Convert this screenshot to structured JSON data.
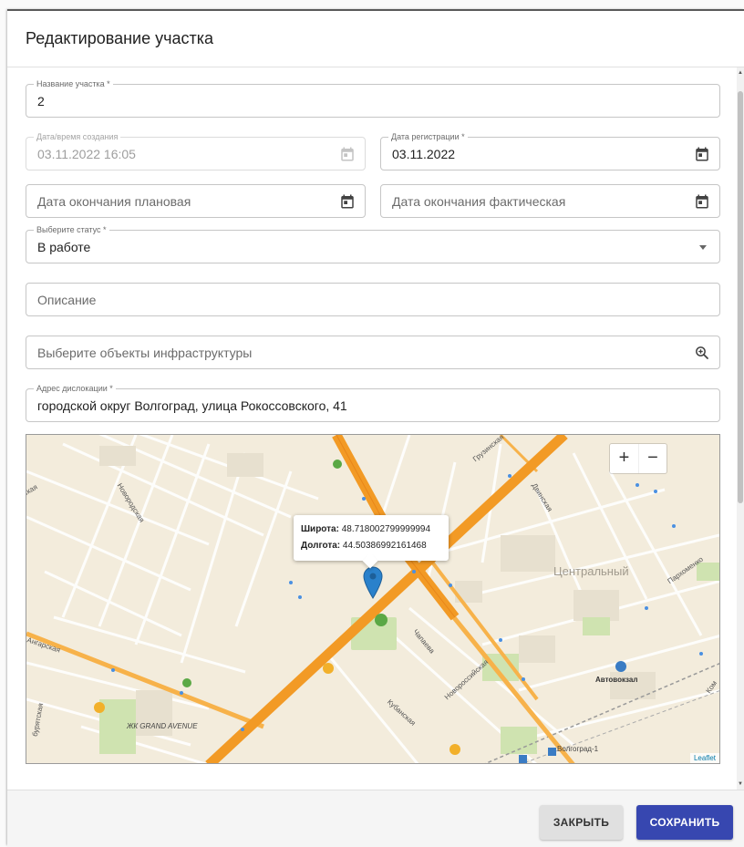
{
  "dialog": {
    "title": "Редактирование участка"
  },
  "form": {
    "name": {
      "label": "Название участка *",
      "value": "2"
    },
    "created": {
      "label": "Дата/время создания",
      "value": "03.11.2022 16:05"
    },
    "registration": {
      "label": "Дата регистрации *",
      "value": "03.11.2022"
    },
    "planned_end": {
      "placeholder": "Дата окончания плановая"
    },
    "actual_end": {
      "placeholder": "Дата окончания фактическая"
    },
    "status": {
      "label": "Выберите статус *",
      "value": "В работе"
    },
    "description": {
      "placeholder": "Описание"
    },
    "infrastructure": {
      "placeholder": "Выберите объекты инфраструктуры"
    },
    "address": {
      "label": "Адрес дислокации *",
      "value": "городской округ Волгоград, улица Рокоссовского, 41"
    }
  },
  "map": {
    "zoom_in": "+",
    "zoom_out": "−",
    "popup": {
      "lat_label": "Широта:",
      "lat_value": "48.718002799999994",
      "lon_label": "Долгота:",
      "lon_value": "44.50386992161468"
    },
    "attribution": "Leaflet",
    "labels": {
      "gruzinskaya": "Грузинская",
      "dvinskaya": "Двинская",
      "novorodskaya": "Новородская",
      "skaya": "ская",
      "tsentralny": "Центральный",
      "parkhomenko": "Пархоменко",
      "angarskaya": "Ангарская",
      "chapaeva": "Чапаева",
      "novorossiyskaya": "Новороссийская",
      "avtovokzal": "Автовокзал",
      "kubanskaya": "Кубанская",
      "buryatskaya": "бурятская",
      "zhk": "ЖК GRAND AVENUE",
      "volgograd1": "Волгоград-1",
      "kom": "Ком"
    },
    "colors": {
      "road_primary": "#f29a25",
      "road_secondary": "#f7b24a",
      "park": "#cfe3b0",
      "background": "#f3ecdc",
      "marker": "#2a81cb"
    }
  },
  "footer": {
    "close_label": "ЗАКРЫТЬ",
    "save_label": "СОХРАНИТЬ"
  }
}
